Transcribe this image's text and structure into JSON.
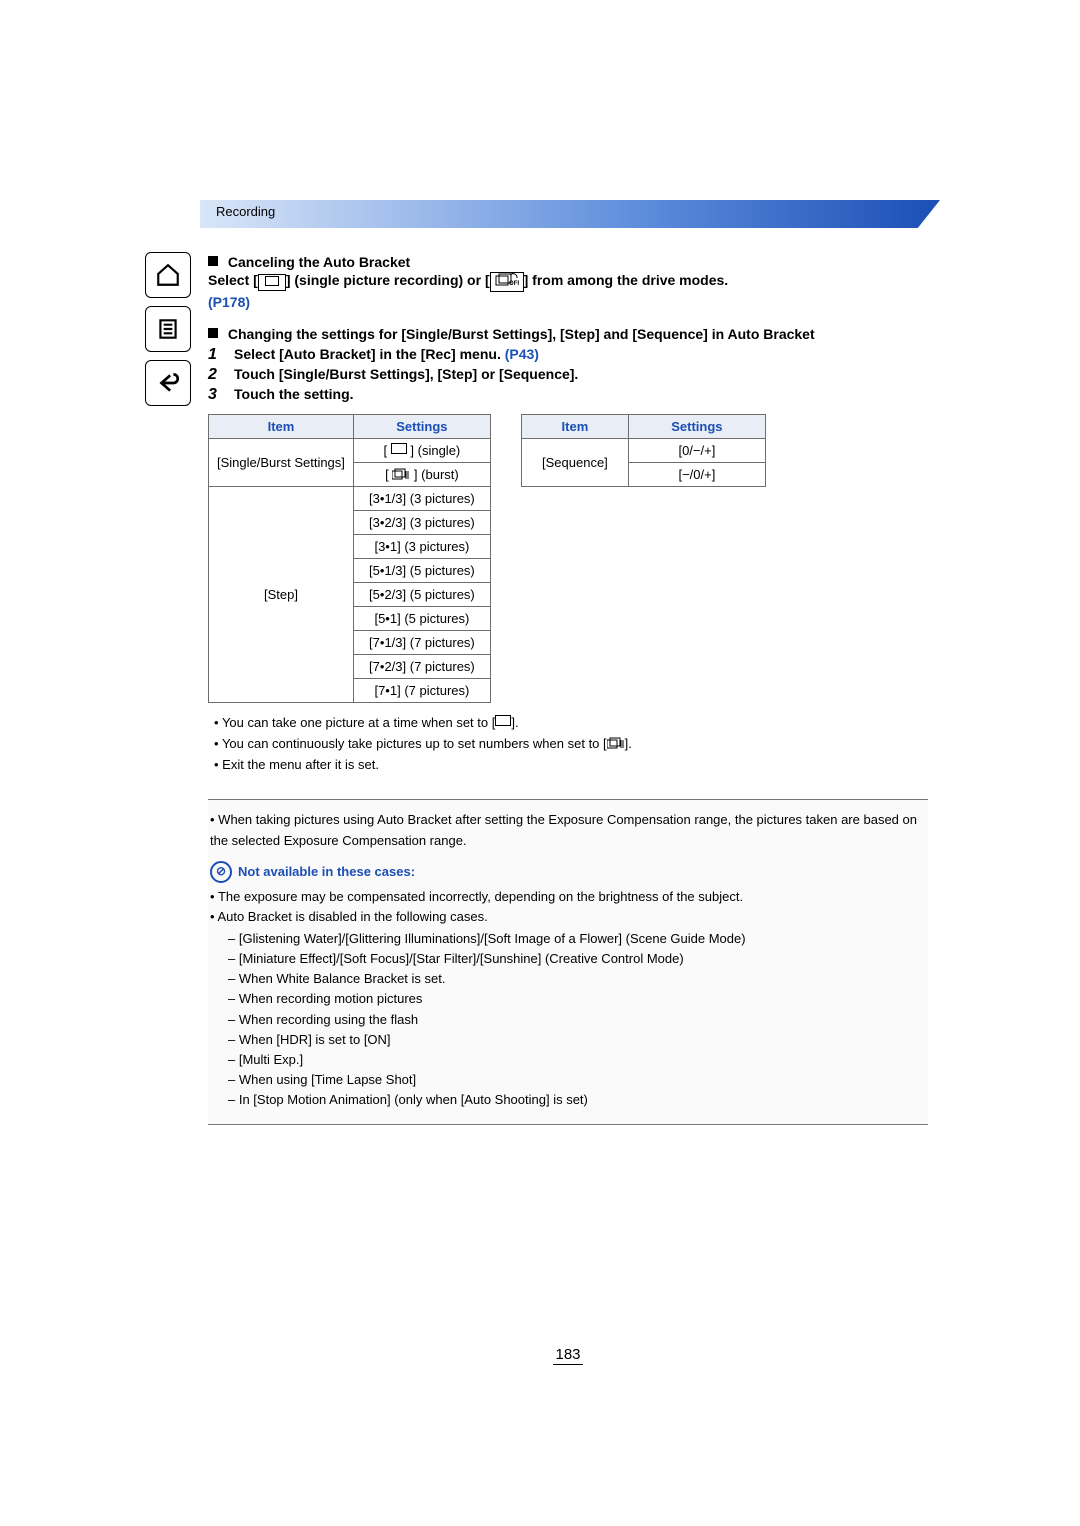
{
  "header": {
    "section": "Recording"
  },
  "cancel": {
    "heading": "Canceling the Auto Bracket",
    "text_before": "Select [",
    "text_mid": "] (single picture recording) or [",
    "text_after": "] from among the drive modes.",
    "ref": "(P178)"
  },
  "change": {
    "heading": "Changing the settings for [Single/Burst Settings], [Step] and [Sequence] in Auto Bracket",
    "steps": {
      "s1_num": "1",
      "s1_text_a": "Select [Auto Bracket] in the [Rec] menu. ",
      "s1_ref": "(P43)",
      "s2_num": "2",
      "s2_text": "Touch [Single/Burst Settings], [Step] or [Sequence].",
      "s3_num": "3",
      "s3_text": "Touch the setting."
    }
  },
  "tables": {
    "h_item": "Item",
    "h_settings": "Settings",
    "left": {
      "row1_label": "[Single/Burst Settings]",
      "row1_opt1_suffix": " (single)",
      "row1_opt2_suffix": " (burst)",
      "step_label": "[Step]",
      "step_opts": [
        "[3•1/3] (3 pictures)",
        "[3•2/3] (3 pictures)",
        "[3•1] (3 pictures)",
        "[5•1/3] (5 pictures)",
        "[5•2/3] (5 pictures)",
        "[5•1] (5 pictures)",
        "[7•1/3] (7 pictures)",
        "[7•2/3] (7 pictures)",
        "[7•1] (7 pictures)"
      ]
    },
    "right": {
      "seq_label": "[Sequence]",
      "seq_opts": [
        "[0/−/+]",
        "[−/0/+]"
      ]
    }
  },
  "bullets": {
    "b1_pre": "You can take one picture at a time when set to [",
    "b1_post": "].",
    "b2_pre": "You can continuously take pictures up to set numbers when set to [",
    "b2_post": "].",
    "b3": "Exit the menu after it is set."
  },
  "notes": {
    "p1": "When taking pictures using Auto Bracket after setting the Exposure Compensation range, the pictures taken are based on the selected Exposure Compensation range.",
    "title": "Not available in these cases:",
    "p2": "The exposure may be compensated incorrectly, depending on the brightness of the subject.",
    "p3": "Auto Bracket is disabled in the following cases.",
    "dashes": [
      "[Glistening Water]/[Glittering Illuminations]/[Soft Image of a Flower] (Scene Guide Mode)",
      "[Miniature Effect]/[Soft Focus]/[Star Filter]/[Sunshine] (Creative Control Mode)",
      "When White Balance Bracket is set.",
      "When recording motion pictures",
      "When recording using the flash",
      "When [HDR] is set to [ON]",
      "[Multi Exp.]",
      "When using [Time Lapse Shot]",
      "In [Stop Motion Animation] (only when [Auto Shooting] is set)"
    ]
  },
  "page_number": "183"
}
